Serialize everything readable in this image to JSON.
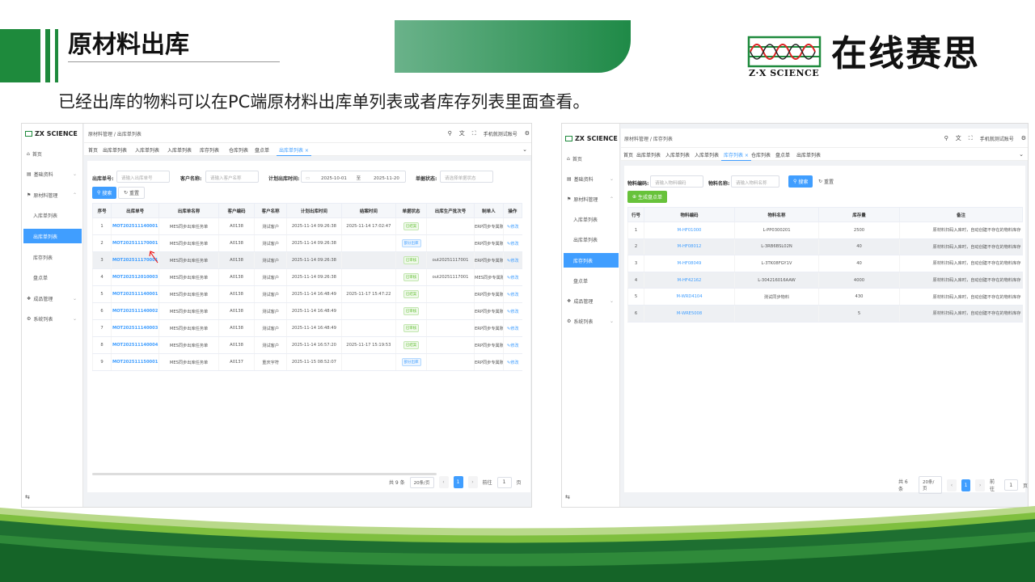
{
  "slide": {
    "title": "原材料出库",
    "subtitle": "已经出库的物料可以在PC端原材料出库单列表或者库存列表里面查看。",
    "logo_sub": "Z·X SCIENCE",
    "logo_cn": "在线赛思",
    "colors": {
      "green": "#1e8a3c",
      "blue": "#409eff"
    }
  },
  "left": {
    "brand": "ZX SCIENCE",
    "menu": [
      {
        "icon": "home-icon",
        "label": "首页"
      },
      {
        "icon": "doc-icon",
        "label": "基础资料",
        "arrow": "⌄"
      },
      {
        "icon": "material-icon",
        "label": "原材料管理",
        "arrow": "⌃"
      },
      {
        "label": "入库单列表"
      },
      {
        "label": "出库单列表",
        "active": true
      },
      {
        "label": "库存列表"
      },
      {
        "label": "盘点单"
      },
      {
        "icon": "product-icon",
        "label": "成品管理",
        "arrow": "⌄"
      },
      {
        "icon": "gear-icon",
        "label": "系统列表",
        "arrow": "⌄"
      }
    ],
    "collapse": "⇆",
    "breadcrumb": "原材料管理 / 出库单列表",
    "user": "手机就测试账号",
    "tabs": [
      "首页",
      "出库单列表",
      "入库单列表",
      "入库单列表",
      "库存列表",
      "仓库列表",
      "盘点单",
      "出库单列表 ×"
    ],
    "filters": {
      "order_label": "出库单号:",
      "order_ph": "请输入出库单号",
      "customer_label": "客户名称:",
      "customer_ph": "请输入客户名称",
      "time_label": "计划出库时间:",
      "date_from": "2025-10-01",
      "date_sep": "至",
      "date_to": "2025-11-20",
      "status_label": "单据状态:",
      "status_ph": "请选择单据状态"
    },
    "search_btn": "搜索",
    "reset_btn": "重置",
    "columns": [
      "序号",
      "出库单号",
      "出库单名称",
      "客户编码",
      "客户名称",
      "计划出库时间",
      "结案时间",
      "单据状态",
      "出库生产批次号",
      "制单人",
      "操作"
    ],
    "rows": [
      {
        "no": "1",
        "code": "MOT202511140001",
        "name": "MES同步出库任务单",
        "ccode": "A0138",
        "cname": "测试客户",
        "plan": "2025-11-14 09:26:38",
        "close": "2025-11-14 17:02:47",
        "status": "已结案",
        "stype": "green",
        "batch": "",
        "maker": "ERP同步专属账",
        "op": "修改"
      },
      {
        "no": "2",
        "code": "MOT202511170001",
        "name": "MES同步出库任务单",
        "ccode": "A0138",
        "cname": "测试客户",
        "plan": "2025-11-14 09:26:38",
        "close": "",
        "status": "部分出库",
        "stype": "blue",
        "batch": "",
        "maker": "ERP同步专属账",
        "op": "修改"
      },
      {
        "no": "3",
        "code": "MOT202511170001",
        "name": "MES同步出库任务单",
        "ccode": "A0138",
        "cname": "测试客户",
        "plan": "2025-11-14 09:26:38",
        "close": "",
        "status": "已审核",
        "stype": "green",
        "batch": "out20251117001",
        "maker": "ERP同步专属账",
        "op": "修改",
        "hl": true
      },
      {
        "no": "4",
        "code": "MOT202512010003",
        "name": "MES同步出库任务单",
        "ccode": "A0138",
        "cname": "测试客户",
        "plan": "2025-11-14 09:26:38",
        "close": "",
        "status": "已审核",
        "stype": "green",
        "batch": "out20251117001",
        "maker": "MES同步专属账",
        "op": "修改"
      },
      {
        "no": "5",
        "code": "MOT202511140001",
        "name": "MES同步出库任务单",
        "ccode": "A0138",
        "cname": "测试客户",
        "plan": "2025-11-14 16:48:49",
        "close": "2025-11-17 15:47:22",
        "status": "已结案",
        "stype": "green",
        "batch": "",
        "maker": "ERP同步专属账",
        "op": "修改"
      },
      {
        "no": "6",
        "code": "MOT202511140002",
        "name": "MES同步出库任务单",
        "ccode": "A0138",
        "cname": "测试客户",
        "plan": "2025-11-14 16:48:49",
        "close": "",
        "status": "已审核",
        "stype": "green",
        "batch": "",
        "maker": "ERP同步专属账",
        "op": "修改"
      },
      {
        "no": "7",
        "code": "MOT202511140003",
        "name": "MES同步出库任务单",
        "ccode": "A0138",
        "cname": "测试客户",
        "plan": "2025-11-14 16:48:49",
        "close": "",
        "status": "已审核",
        "stype": "green",
        "batch": "",
        "maker": "ERP同步专属账",
        "op": "修改"
      },
      {
        "no": "8",
        "code": "MOT202511140004",
        "name": "MES同步出库任务单",
        "ccode": "A0138",
        "cname": "测试客户",
        "plan": "2025-11-14 16:57:20",
        "close": "2025-11-17 15:19:53",
        "status": "已结案",
        "stype": "green",
        "batch": "",
        "maker": "ERP同步专属账",
        "op": "修改"
      },
      {
        "no": "9",
        "code": "MOT202511150001",
        "name": "MES同步出库任务单",
        "ccode": "A0137",
        "cname": "重庆字符",
        "plan": "2025-11-15 08:52:07",
        "close": "",
        "status": "部分出库",
        "stype": "blue",
        "batch": "",
        "maker": "ERP同步专属账",
        "op": "修改"
      }
    ],
    "pager": {
      "total": "共 9 条",
      "size": "20条/页",
      "page": "1",
      "goto": "前往",
      "unit": "页"
    }
  },
  "right": {
    "brand": "ZX SCIENCE",
    "menu": [
      {
        "icon": "home-icon",
        "label": "首页"
      },
      {
        "icon": "doc-icon",
        "label": "基础资料",
        "arrow": "⌄"
      },
      {
        "icon": "material-icon",
        "label": "原材料管理",
        "arrow": "⌃"
      },
      {
        "label": "入库单列表"
      },
      {
        "label": "出库单列表"
      },
      {
        "label": "库存列表",
        "active": true
      },
      {
        "label": "盘点单"
      },
      {
        "icon": "product-icon",
        "label": "成品管理",
        "arrow": "⌄"
      },
      {
        "icon": "gear-icon",
        "label": "系统列表",
        "arrow": "⌄"
      }
    ],
    "collapse": "⇆",
    "breadcrumb": "原材料管理 / 库存列表",
    "user": "手机就测试账号",
    "tabs": [
      "首页",
      "出库单列表",
      "入库单列表",
      "入库单列表",
      "库存列表 ×",
      "仓库列表",
      "盘点单",
      "出库单列表"
    ],
    "filters": {
      "code_label": "物料编码:",
      "code_ph": "请输入物料编码",
      "name_label": "物料名称:",
      "name_ph": "请输入物料名称"
    },
    "search_btn": "搜索",
    "reset_btn": "重置",
    "gen_btn": "生成盘点单",
    "columns": [
      "行号",
      "物料编码",
      "物料名称",
      "库存量",
      "备注"
    ],
    "rows": [
      {
        "no": "1",
        "code": "M-HF01000",
        "name": "L-PP0300201",
        "qty": "2500",
        "note": "原材料扫码入库时，自动创建不存在的物料库存"
      },
      {
        "no": "2",
        "code": "M-HF08012",
        "name": "L-3RB6BSL02N",
        "qty": "40",
        "note": "原材料扫码入库时，自动创建不存在的物料库存"
      },
      {
        "no": "3",
        "code": "M-HF08049",
        "name": "L-3TK08FGY1V",
        "qty": "40",
        "note": "原材料扫码入库时，自动创建不存在的物料库存"
      },
      {
        "no": "4",
        "code": "M-HF42162",
        "name": "L-304216016AAW",
        "qty": "4000",
        "note": "原材料扫码入库时，自动创建不存在的物料库存"
      },
      {
        "no": "5",
        "code": "M-WRD4104",
        "name": "测试同步物料",
        "qty": "430",
        "note": "原材料扫码入库时，自动创建不存在的物料库存"
      },
      {
        "no": "6",
        "code": "M-WRE5008",
        "name": "",
        "qty": "5",
        "note": "原材料扫码入库时，自动创建不存在的物料库存"
      }
    ],
    "pager": {
      "total": "共 6 条",
      "size": "20条/页",
      "page": "1",
      "goto": "前往",
      "unit": "页"
    }
  }
}
